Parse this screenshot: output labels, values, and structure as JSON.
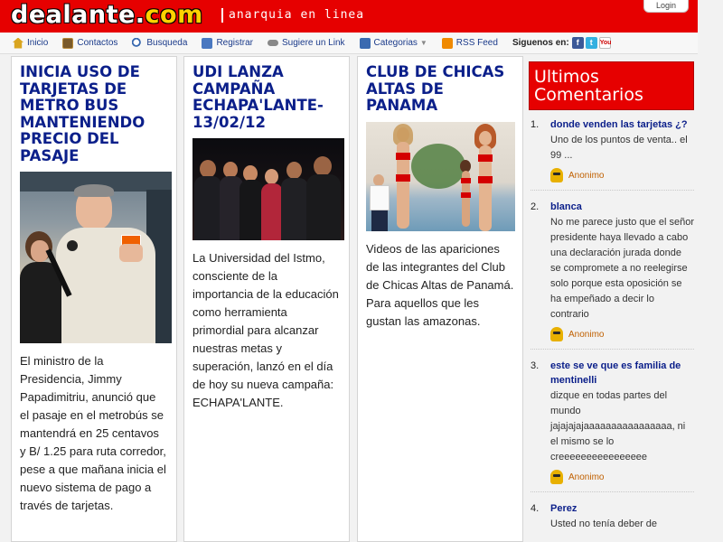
{
  "header": {
    "logo_main": "dealante.",
    "logo_com": "com",
    "tagline": "anarquia en linea",
    "login_label": "Login"
  },
  "nav": {
    "items": [
      {
        "label": "Inicio",
        "icon": "home-icon"
      },
      {
        "label": "Contactos",
        "icon": "contact-book-icon"
      },
      {
        "label": "Busqueda",
        "icon": "search-icon"
      },
      {
        "label": "Registrar",
        "icon": "register-icon"
      },
      {
        "label": "Sugiere un Link",
        "icon": "link-icon"
      },
      {
        "label": "Categorias",
        "icon": "categories-icon"
      },
      {
        "label": "RSS Feed",
        "icon": "rss-icon"
      }
    ],
    "follow_label": "Siguenos en:",
    "social": [
      "f",
      "t",
      "You"
    ]
  },
  "articles": [
    {
      "title": "Inicia uso de tarjetas de metro bus manteniendo precio del pasaje",
      "text": "El ministro de la Presidencia, Jimmy Papadimitriu, anunció que el pasaje en el metrobús se mantendrá en 25 centavos y B/ 1.25 para ruta corredor, pese a que mañana inicia el nuevo sistema de pago a través de tarjetas."
    },
    {
      "title": "UDI lanza campaña Echapa'lante- 13/02/12",
      "text": "La Universidad del Istmo, consciente de la importancia de la educación como herramienta primordial para alcanzar nuestras metas y superación, lanzó en el día de hoy su nueva campaña: ECHAPA'LANTE."
    },
    {
      "title": "Club de chicas altas de Panama",
      "text": "Videos de las apariciones de las integrantes del Club de Chicas Altas de Panamá. Para aquellos que les gustan las amazonas."
    }
  ],
  "sidebar": {
    "heading": "Ultimos Comentarios",
    "comments": [
      {
        "num": "1.",
        "title": "donde venden las tarjetas ¿?",
        "body": "Uno de los puntos de venta.. el 99 ...",
        "author": "Anonimo"
      },
      {
        "num": "2.",
        "title": "blanca",
        "body": "No me parece justo que el señor presidente haya llevado a cabo una declaración jurada donde se compromete a no reelegirse solo porque esta oposición se ha empeñado a decir lo contrario",
        "author": "Anonimo"
      },
      {
        "num": "3.",
        "title": "este se ve que es familia de mentinelli",
        "body": "dizque en todas partes del mundo jajajajajaaaaaaaaaaaaaaaa, ni el mismo se lo creeeeeeeeeeeeeeee",
        "author": "Anonimo"
      },
      {
        "num": "4.",
        "title": "Perez",
        "body": "Usted no tenía deber de",
        "author": ""
      }
    ]
  },
  "colors": {
    "brand_red": "#e60000",
    "title_blue": "#0b1f8a",
    "logo_accent": "#ffd200"
  }
}
